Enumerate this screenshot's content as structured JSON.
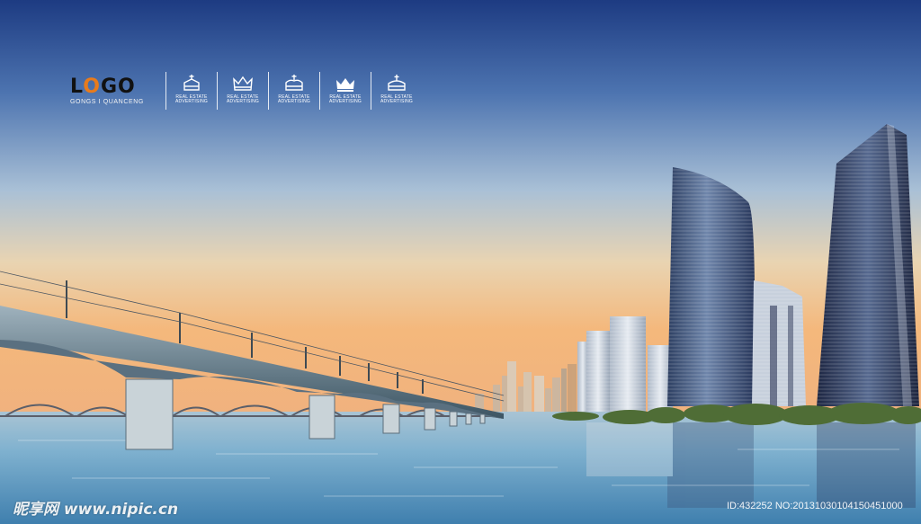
{
  "branding": {
    "logo_text": "LOGO",
    "logo_subtitle": "GONGS I QUANCENG",
    "accent_color": "#e87b1c"
  },
  "badges": [
    {
      "icon": "crown-icon",
      "line1": "REAL ESTATE",
      "line2": "ADVERTISING"
    },
    {
      "icon": "crown-icon",
      "line1": "REAL ESTATE",
      "line2": "ADVERTISING"
    },
    {
      "icon": "crown-icon",
      "line1": "REAL ESTATE",
      "line2": "ADVERTISING"
    },
    {
      "icon": "crown-icon",
      "line1": "REAL ESTATE",
      "line2": "ADVERTISING"
    },
    {
      "icon": "crown-icon",
      "line1": "REAL ESTATE",
      "line2": "ADVERTISING"
    }
  ],
  "watermark": {
    "site": "昵享网 www.nipic.cn",
    "id_text": "ID:432252 NO:20131030104150451000"
  },
  "colors": {
    "sky_top": "#1f3f85",
    "sky_mid": "#c5cfd6",
    "sky_horizon": "#f3b679",
    "water": "#6fa9c9",
    "vegetation": "#4d6a34"
  }
}
